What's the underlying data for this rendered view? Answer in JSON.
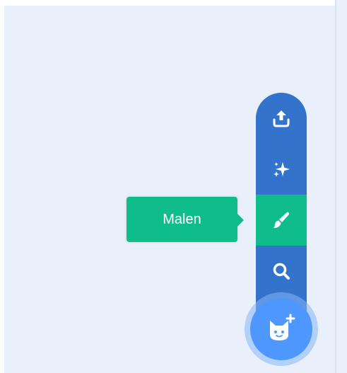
{
  "sprite_menu": {
    "items": [
      {
        "name": "upload",
        "icon": "upload-icon"
      },
      {
        "name": "surprise",
        "icon": "sparkle-icon"
      },
      {
        "name": "paint",
        "icon": "paintbrush-icon"
      },
      {
        "name": "search",
        "icon": "search-icon"
      }
    ],
    "active_item": "paint",
    "tooltip": "Malen",
    "fab_icon": "cat-plus-icon"
  },
  "colors": {
    "menu_background": "#3373cc",
    "active_item": "#0fbd8c",
    "fab": "#4d97ff",
    "fab_halo": "#85b6f5",
    "stage_background": "#e9f0fb"
  }
}
